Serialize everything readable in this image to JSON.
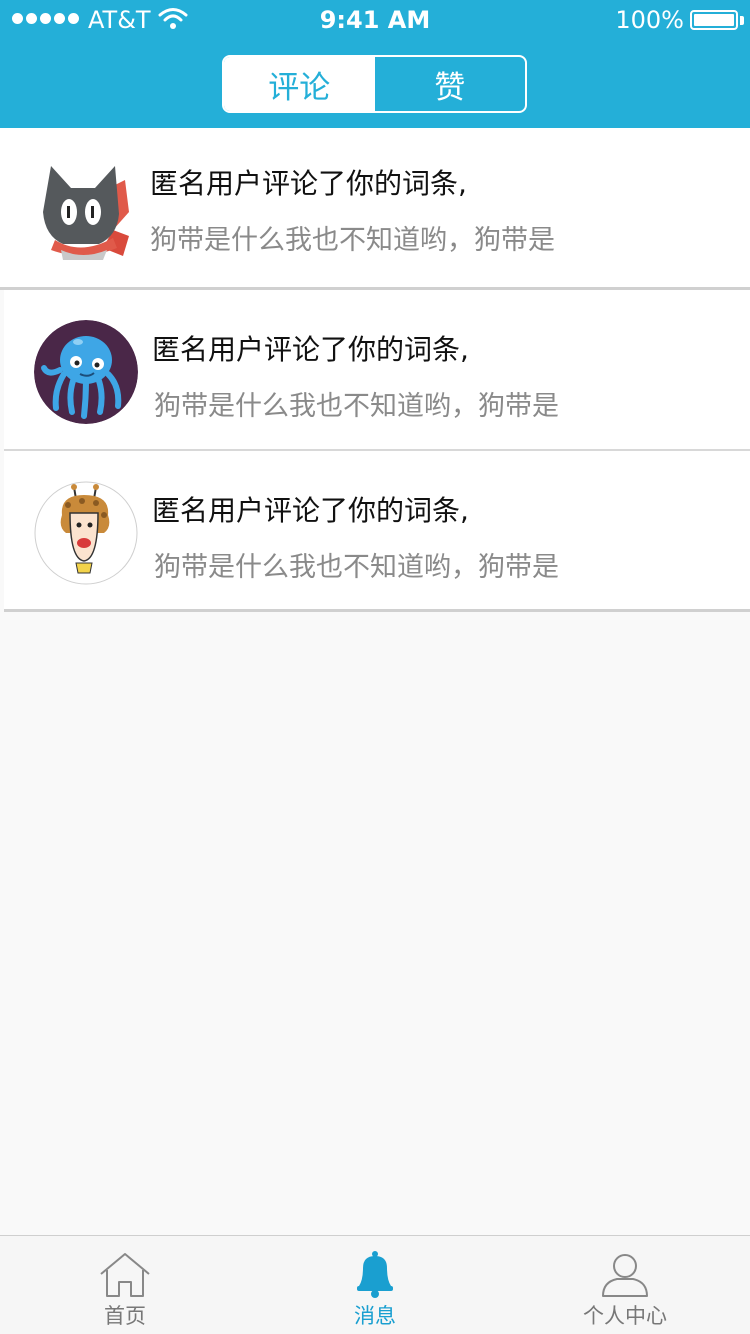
{
  "status_bar": {
    "carrier": "AT&T",
    "time": "9:41 AM",
    "battery": "100%",
    "signal_icon": "signal-dots-icon",
    "wifi_icon": "wifi-icon",
    "battery_icon": "battery-icon"
  },
  "header": {
    "tabs": [
      {
        "label": "评论",
        "active": true
      },
      {
        "label": "赞",
        "active": false
      }
    ],
    "accent_color": "#24afd8"
  },
  "notifications": [
    {
      "avatar": "cat-avatar",
      "title": "匿名用户评论了你的词条,",
      "preview": "狗带是什么我也不知道哟，狗带是"
    },
    {
      "avatar": "octopus-avatar",
      "title": "匿名用户评论了你的词条,",
      "preview": "狗带是什么我也不知道哟，狗带是"
    },
    {
      "avatar": "giraffe-person-avatar",
      "title": "匿名用户评论了你的词条,",
      "preview": "狗带是什么我也不知道哟，狗带是"
    }
  ],
  "tabbar": {
    "items": [
      {
        "label": "首页",
        "icon": "home-icon",
        "active": false
      },
      {
        "label": "消息",
        "icon": "bell-icon",
        "active": true
      },
      {
        "label": "个人中心",
        "icon": "person-icon",
        "active": false
      }
    ]
  }
}
